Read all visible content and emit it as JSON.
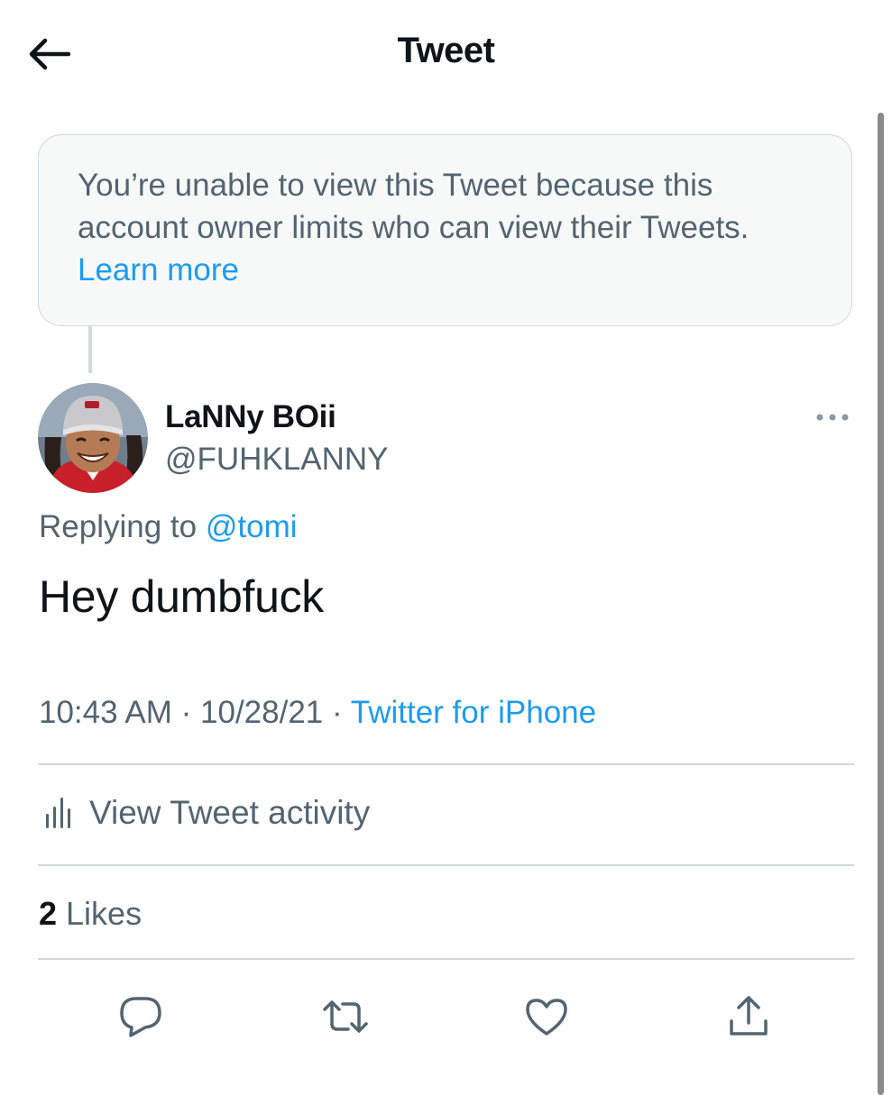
{
  "header": {
    "title": "Tweet",
    "back_icon": "arrow-left-icon"
  },
  "notice": {
    "text": "You’re unable to view this Tweet because this account owner limits who can view their Tweets.",
    "link_label": "Learn more"
  },
  "tweet": {
    "author": {
      "display_name": "LaNNy BOii",
      "handle": "@FUHKLANNY",
      "avatar_icon": "avatar-photo"
    },
    "more_icon": "more-horizontal-icon",
    "replying_prefix": "Replying to",
    "replying_to": "@tomi",
    "text": "Hey dumbfuck",
    "time": "10:43 AM",
    "separator": "·",
    "date": "10/28/21",
    "source": "Twitter for iPhone"
  },
  "activity": {
    "label": "View Tweet activity",
    "icon": "analytics-bars-icon"
  },
  "likes": {
    "count": "2",
    "label": "Likes"
  },
  "actions": {
    "reply_icon": "reply-bubble-icon",
    "retweet_icon": "retweet-icon",
    "like_icon": "heart-icon",
    "share_icon": "share-icon"
  },
  "colors": {
    "accent": "#1d9bf0",
    "text": "#0f1419",
    "secondary": "#536471",
    "border": "#cfd9de",
    "notice_bg": "#f7f9f9"
  }
}
